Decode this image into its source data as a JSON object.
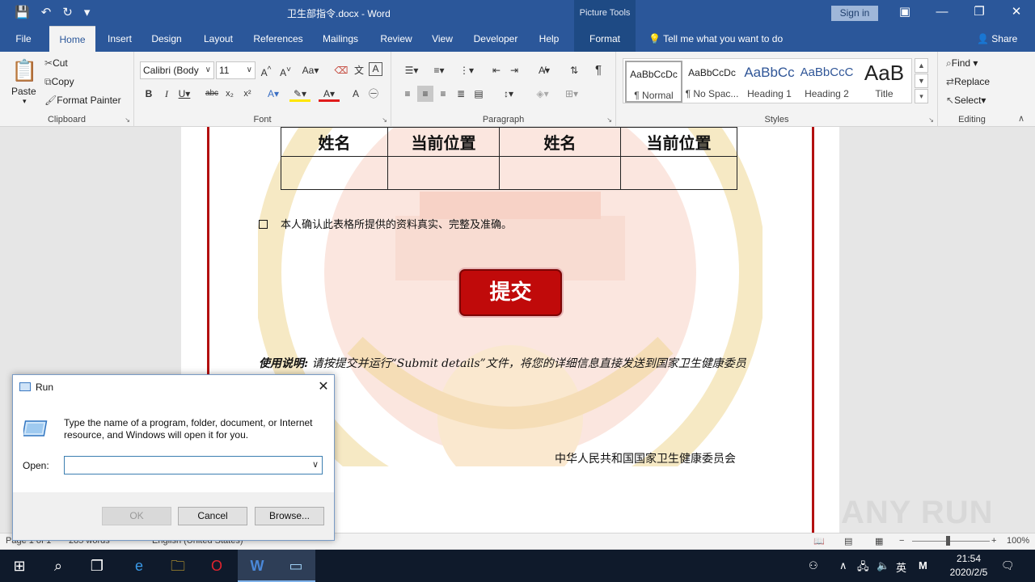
{
  "titlebar": {
    "doc_title": "卫生部指令.docx  -  Word",
    "context_tab": "Picture Tools",
    "signin": "Sign in"
  },
  "tabs": [
    "File",
    "Home",
    "Insert",
    "Design",
    "Layout",
    "References",
    "Mailings",
    "Review",
    "View",
    "Developer",
    "Help",
    "Format"
  ],
  "tell_me": "Tell me what you want to do",
  "share": "Share",
  "clipboard": {
    "paste": "Paste",
    "cut": "Cut",
    "copy": "Copy",
    "format_painter": "Format Painter",
    "label": "Clipboard"
  },
  "font": {
    "name": "Calibri (Body",
    "size": "11",
    "label": "Font"
  },
  "paragraph": {
    "label": "Paragraph"
  },
  "styles": {
    "label": "Styles",
    "items": [
      {
        "sample": "AaBbCcDc",
        "name": "¶ Normal"
      },
      {
        "sample": "AaBbCcDc",
        "name": "¶ No Spac..."
      },
      {
        "sample": "AaBbCc",
        "name": "Heading 1"
      },
      {
        "sample": "AaBbCcC",
        "name": "Heading 2"
      },
      {
        "sample": "AaB",
        "name": "Title"
      }
    ]
  },
  "editing": {
    "find": "Find",
    "replace": "Replace",
    "select": "Select",
    "label": "Editing"
  },
  "document": {
    "table_headers": [
      "姓名",
      "当前位置",
      "姓名",
      "当前位置"
    ],
    "confirm_text": "本人确认此表格所提供的资料真实、完整及准确。",
    "submit_label": "提交",
    "usage_bold": "使用说明:",
    "usage_text": " 请按提交并运行“Submit details”文件，将您的详细信息直接发送到国家卫生健康委员会。",
    "signature": "中华人民共和国国家卫生健康委员会"
  },
  "statusbar": {
    "page": "Page 1 of 1",
    "words": "285 words",
    "language": "English (United States)",
    "zoom": "100%"
  },
  "run_dialog": {
    "title": "Run",
    "description": "Type the name of a program, folder, document, or Internet resource, and Windows will open it for you.",
    "open_label": "Open:",
    "open_value": "",
    "ok": "OK",
    "cancel": "Cancel",
    "browse": "Browse..."
  },
  "taskbar": {
    "time": "21:54",
    "date": "2020/2/5",
    "ime": "英"
  },
  "watermark": "ANY RUN",
  "colors": {
    "word_blue": "#2b579a",
    "border_red": "#b31010",
    "submit_red": "#c00a0a"
  }
}
